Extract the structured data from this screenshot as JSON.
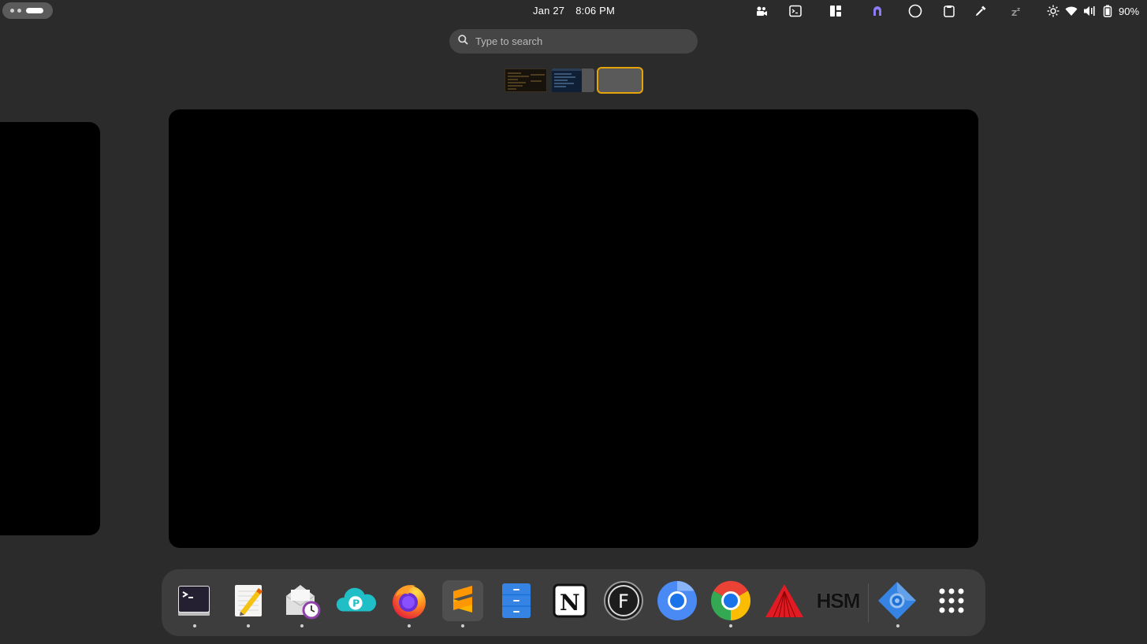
{
  "topbar": {
    "date": "Jan 27",
    "time": "8:06 PM",
    "battery_percent": "90%",
    "tray_icons": [
      "video-call-icon",
      "terminal-icon",
      "tiling-layout-icon",
      "vpn-icon",
      "circle-icon",
      "clipboard-icon",
      "color-picker-icon",
      "sleep-icon"
    ],
    "system_icons": [
      "brightness-icon",
      "wifi-icon",
      "volume-icon",
      "battery-icon"
    ]
  },
  "search": {
    "placeholder": "Type to search"
  },
  "workspaces": {
    "count": 3,
    "active_index": 2
  },
  "dock": {
    "items": [
      {
        "name": "terminal",
        "running": true
      },
      {
        "name": "text-editor",
        "running": true
      },
      {
        "name": "mail-scheduler",
        "running": true
      },
      {
        "name": "pcloud",
        "running": false
      },
      {
        "name": "firefox",
        "running": true
      },
      {
        "name": "sublime-text",
        "running": true
      },
      {
        "name": "file-manager",
        "running": false
      },
      {
        "name": "notion",
        "running": false
      },
      {
        "name": "f-app",
        "running": false
      },
      {
        "name": "chromium",
        "running": false
      },
      {
        "name": "google-chrome",
        "running": true
      },
      {
        "name": "red-triangle-app",
        "running": false
      },
      {
        "name": "hsm",
        "running": false
      },
      {
        "name": "app-installer",
        "running": true
      },
      {
        "name": "show-apps",
        "running": false
      }
    ],
    "hsm_label": "HSM"
  },
  "colors": {
    "accent": "#e5a50a",
    "panel": "#2b2b2b",
    "dock": "#3d3d3d"
  }
}
